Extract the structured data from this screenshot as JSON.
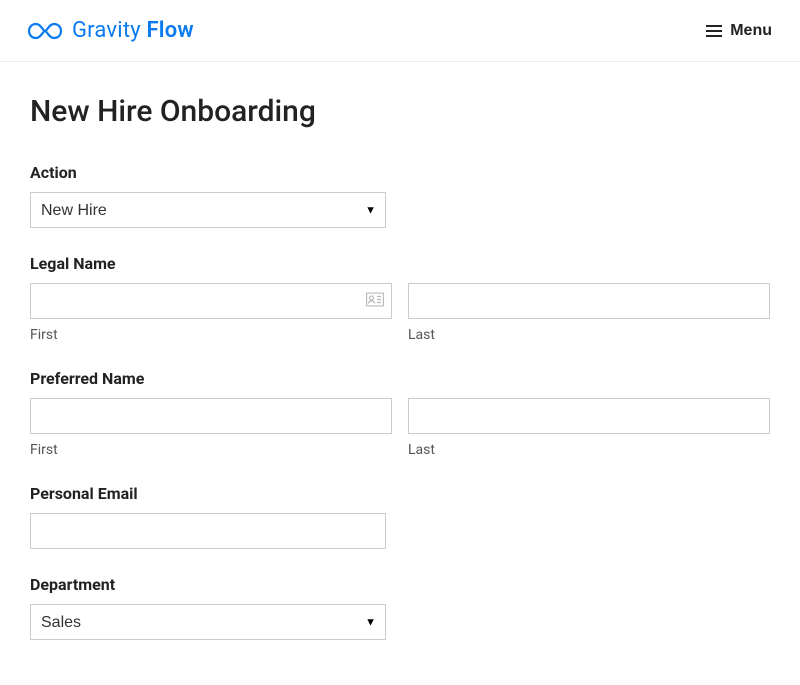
{
  "header": {
    "brand_a": "Gravity",
    "brand_b": "Flow",
    "menu_label": "Menu"
  },
  "page": {
    "title": "New Hire Onboarding"
  },
  "form": {
    "action": {
      "label": "Action",
      "value": "New Hire"
    },
    "legal_name": {
      "label": "Legal Name",
      "first_sub": "First",
      "last_sub": "Last",
      "first_value": "",
      "last_value": ""
    },
    "preferred_name": {
      "label": "Preferred Name",
      "first_sub": "First",
      "last_sub": "Last",
      "first_value": "",
      "last_value": ""
    },
    "personal_email": {
      "label": "Personal Email",
      "value": ""
    },
    "department": {
      "label": "Department",
      "value": "Sales"
    }
  }
}
